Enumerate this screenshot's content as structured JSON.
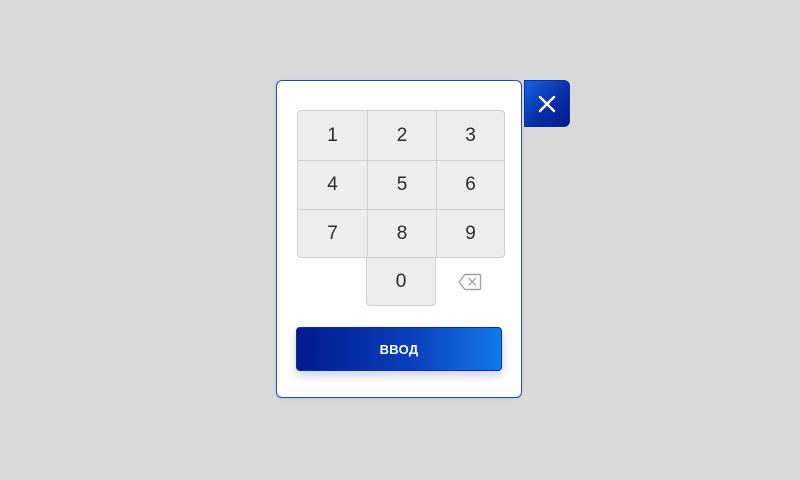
{
  "keypad": {
    "keys": [
      "1",
      "2",
      "3",
      "4",
      "5",
      "6",
      "7",
      "8",
      "9"
    ],
    "zero": "0",
    "backspace_icon": "backspace-icon"
  },
  "actions": {
    "enter_label": "ВВОД",
    "close_icon": "close-icon"
  },
  "colors": {
    "accent_dark": "#001a8c",
    "accent_light": "#1279ea",
    "key_bg": "#ededed",
    "background": "#d9d9d9"
  }
}
